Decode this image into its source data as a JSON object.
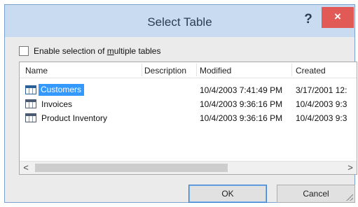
{
  "window": {
    "title": "Select Table",
    "help_label": "?",
    "close_label": "×"
  },
  "options": {
    "multi_select_prefix": "Enable selection of ",
    "multi_select_accel": "m",
    "multi_select_rest": "ultiple tables",
    "multi_select_checked": false
  },
  "table_list": {
    "columns": [
      "Name",
      "Description",
      "Modified",
      "Created"
    ],
    "rows": [
      {
        "name": "Customers",
        "description": "",
        "modified": "10/4/2003 7:41:49 PM",
        "created": "3/17/2001 12:",
        "icon": "table-icon",
        "selected": true
      },
      {
        "name": "Invoices",
        "description": "",
        "modified": "10/4/2003 9:36:16 PM",
        "created": "10/4/2003 9:3",
        "icon": "table-icon",
        "selected": false
      },
      {
        "name": "Product Inventory",
        "description": "",
        "modified": "10/4/2003 9:36:16 PM",
        "created": "10/4/2003 9:3",
        "icon": "table-icon",
        "selected": false
      }
    ],
    "scroll_left": "<",
    "scroll_right": ">"
  },
  "buttons": {
    "ok_label": "OK",
    "cancel_label": "Cancel"
  },
  "colors": {
    "titlebar": "#c9dbf0",
    "close": "#e25a55",
    "selection": "#3399ff"
  }
}
